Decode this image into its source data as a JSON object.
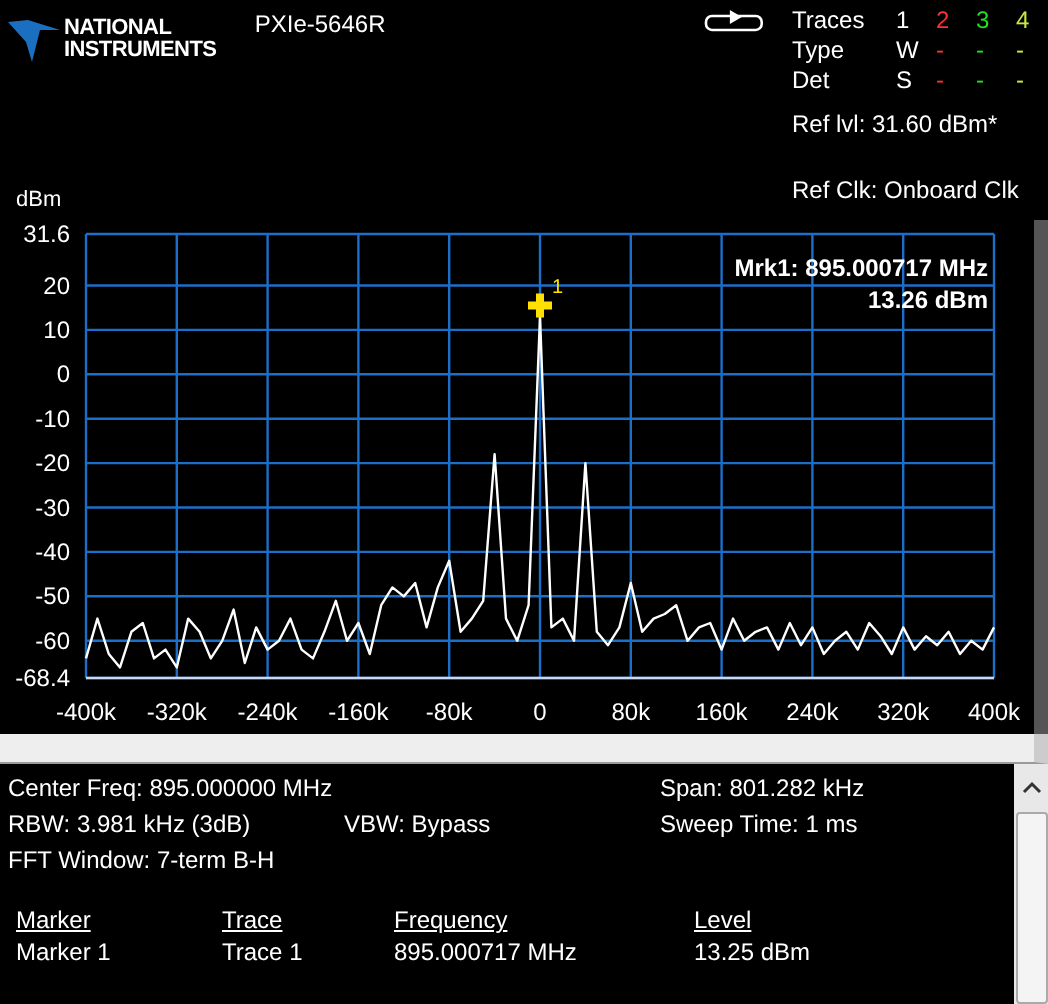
{
  "header": {
    "logo_text": [
      "NATIONAL",
      "INSTRUMENTS"
    ],
    "device": "PXIe-5646R",
    "traces": {
      "title": "Traces",
      "columns": [
        {
          "label": "1",
          "color": "#ffffff"
        },
        {
          "label": "2",
          "color": "#ff3030"
        },
        {
          "label": "3",
          "color": "#20e020"
        },
        {
          "label": "4",
          "color": "#c8e840"
        }
      ],
      "rows": [
        {
          "label": "Type",
          "values": [
            "W",
            "-",
            "-",
            "-"
          ]
        },
        {
          "label": "Det",
          "values": [
            "S",
            "-",
            "-",
            "-"
          ]
        }
      ]
    },
    "ref_level": "Ref lvl: 31.60 dBm*",
    "ref_clock": "Ref Clk: Onboard Clk"
  },
  "spectrum": {
    "marker_readout": [
      "Mrk1: 895.000717 MHz",
      "13.26 dBm"
    ],
    "chart_data": {
      "type": "line",
      "grid": true,
      "ylabel": "dBm",
      "xlim": [
        -400,
        400
      ],
      "ylim": [
        -68.4,
        31.6
      ],
      "xticks": [
        {
          "value": -400,
          "label": "-400k"
        },
        {
          "value": -320,
          "label": "-320k"
        },
        {
          "value": -240,
          "label": "-240k"
        },
        {
          "value": -160,
          "label": "-160k"
        },
        {
          "value": -80,
          "label": "-80k"
        },
        {
          "value": 0,
          "label": "0"
        },
        {
          "value": 80,
          "label": "80k"
        },
        {
          "value": 160,
          "label": "160k"
        },
        {
          "value": 240,
          "label": "240k"
        },
        {
          "value": 320,
          "label": "320k"
        },
        {
          "value": 400,
          "label": "400k"
        }
      ],
      "yticks": [
        31.6,
        20,
        10,
        0,
        -10,
        -20,
        -30,
        -40,
        -50,
        -60,
        -68.4
      ],
      "x": [
        -400,
        -390,
        -380,
        -370,
        -360,
        -350,
        -340,
        -330,
        -320,
        -310,
        -300,
        -290,
        -280,
        -270,
        -260,
        -250,
        -240,
        -230,
        -220,
        -210,
        -200,
        -190,
        -180,
        -170,
        -160,
        -150,
        -140,
        -130,
        -120,
        -110,
        -100,
        -90,
        -80,
        -70,
        -60,
        -50,
        -40,
        -30,
        -20,
        -10,
        0,
        10,
        20,
        30,
        40,
        50,
        60,
        70,
        80,
        90,
        100,
        110,
        120,
        130,
        140,
        150,
        160,
        170,
        180,
        190,
        200,
        210,
        220,
        230,
        240,
        250,
        260,
        270,
        280,
        290,
        300,
        310,
        320,
        330,
        340,
        350,
        360,
        370,
        380,
        390,
        400
      ],
      "series": [
        {
          "color": "#ffffff",
          "values": [
            -64,
            -55,
            -63,
            -66,
            -58,
            -56,
            -64,
            -62,
            -66,
            -55,
            -58,
            -64,
            -60,
            -53,
            -65,
            -57,
            -62,
            -60,
            -55,
            -62,
            -64,
            -58,
            -51,
            -60,
            -56,
            -63,
            -52,
            -48,
            -50,
            -47,
            -57,
            -48,
            -42,
            -58,
            -55,
            -51,
            -18,
            -55,
            -60,
            -52,
            13,
            -57,
            -55,
            -60,
            -20,
            -58,
            -61,
            -57,
            -47,
            -58,
            -55,
            -54,
            -52,
            -60,
            -57,
            -56,
            -62,
            -55,
            -60,
            -58,
            -57,
            -62,
            -56,
            -61,
            -57,
            -63,
            -60,
            -58,
            -62,
            -56,
            -59,
            -63,
            -57,
            -62,
            -59,
            -61,
            -58,
            -63,
            -60,
            -62,
            -57
          ]
        }
      ],
      "annotations": [
        {
          "x": 0,
          "y": 13.26,
          "text": "1"
        }
      ]
    }
  },
  "settings": [
    {
      "left": "Center Freq: 895.000000 MHz",
      "right": "Span: 801.282 kHz"
    },
    {
      "left": "RBW: 3.981 kHz (3dB)",
      "middle": "VBW: Bypass",
      "right": "Sweep Time: 1 ms"
    },
    {
      "left": "FFT Window: 7-term B-H"
    }
  ],
  "markers": {
    "columns": [
      "Marker",
      "Trace",
      "Frequency",
      "Level"
    ],
    "rows": [
      [
        "Marker 1",
        "Trace 1",
        "895.000717 MHz",
        "13.25 dBm"
      ]
    ]
  }
}
